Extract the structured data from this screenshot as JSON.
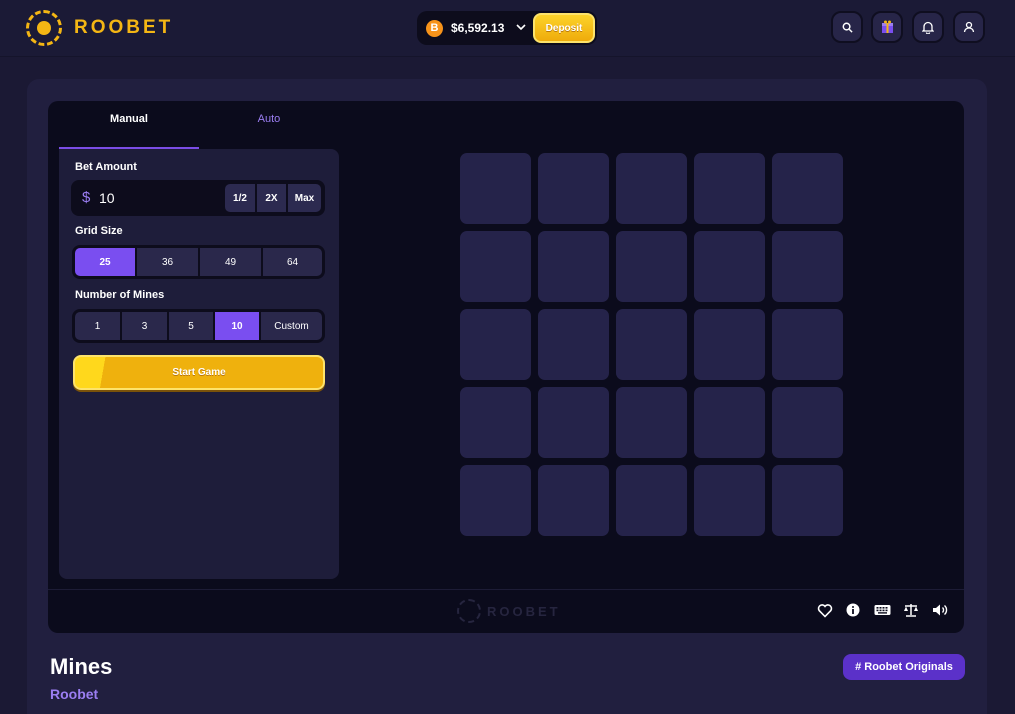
{
  "header": {
    "logo_text": "ROOBET",
    "wallet": {
      "currency_icon": "bitcoin-icon",
      "currency_symbol": "B",
      "balance": "$6,592.13",
      "deposit_label": "Deposit"
    },
    "icons": [
      "search-icon",
      "gift-icon",
      "bell-icon",
      "user-icon"
    ]
  },
  "tabs": {
    "manual": "Manual",
    "auto": "Auto"
  },
  "bet": {
    "label": "Bet Amount",
    "currency": "$",
    "value": "10",
    "buttons": [
      "1/2",
      "2X",
      "Max"
    ]
  },
  "grid_size": {
    "label": "Grid Size",
    "options": [
      "25",
      "36",
      "49",
      "64"
    ],
    "selected": "25"
  },
  "mines": {
    "label": "Number of Mines",
    "options": [
      "1",
      "3",
      "5",
      "10",
      "Custom"
    ],
    "selected": "10"
  },
  "start_label": "Start Game",
  "board": {
    "rows": 5,
    "cols": 5
  },
  "footer": {
    "logo_text": "ROOBET",
    "icons": [
      "heart-icon",
      "info-icon",
      "keyboard-icon",
      "balance-scale-icon",
      "volume-icon"
    ]
  },
  "game": {
    "title": "Mines",
    "provider": "Roobet",
    "tag": "# Roobet Originals"
  },
  "colors": {
    "accent": "#7a4ef0",
    "gold": "#f4b614",
    "background": "#1b1934"
  }
}
